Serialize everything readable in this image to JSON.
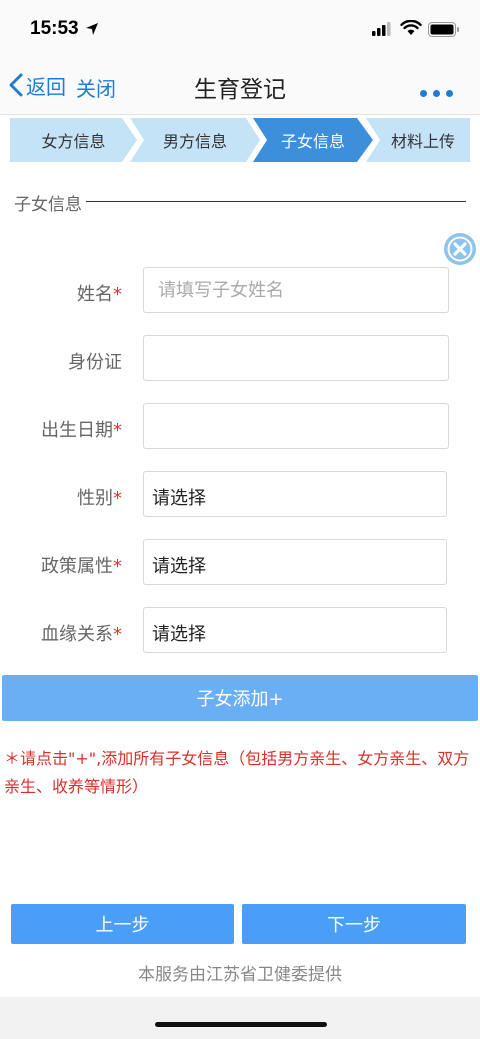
{
  "status": {
    "time": "15:53"
  },
  "nav": {
    "back": "返回",
    "close": "关闭",
    "title": "生育登记"
  },
  "steps": [
    "女方信息",
    "男方信息",
    "子女信息",
    "材料上传"
  ],
  "colors": {
    "accent": "#1e7bd6",
    "step_active": "#3d8fdc",
    "step_inactive": "#c5e3f7",
    "required": "#d9302c",
    "add_button": "#6aaef3",
    "primary_button": "#4a9ef5"
  },
  "section": {
    "title": "子女信息"
  },
  "form": {
    "name": {
      "label": "姓名",
      "required": "*",
      "placeholder": "请填写子女姓名"
    },
    "idcard": {
      "label": "身份证"
    },
    "birth": {
      "label": "出生日期",
      "required": "*"
    },
    "gender": {
      "label": "性别",
      "required": "*",
      "value": "请选择"
    },
    "policy": {
      "label": "政策属性",
      "required": "*",
      "value": "请选择"
    },
    "relation": {
      "label": "血缘关系",
      "required": "*",
      "value": "请选择"
    }
  },
  "add_button": "子女添加+",
  "hint": "＊请点击\"+\",添加所有子女信息（包括男方亲生、女方亲生、双方亲生、收养等情形）",
  "buttons": {
    "prev": "上一步",
    "next": "下一步"
  },
  "footer": "本服务由江苏省卫健委提供"
}
